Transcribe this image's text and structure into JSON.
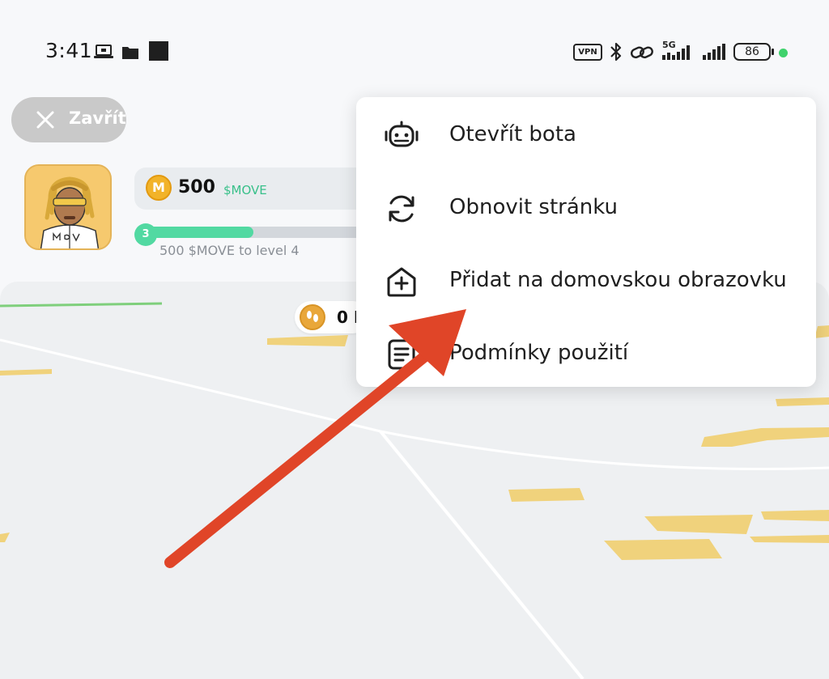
{
  "status_bar": {
    "time": "3:41",
    "vpn_label": "VPN",
    "network_label": "5G",
    "battery": "86",
    "icons": [
      "laptop-icon",
      "folder-icon",
      "square-icon",
      "vpn-icon",
      "bluetooth-icon",
      "link-icon",
      "signal-icon",
      "battery-icon"
    ]
  },
  "header": {
    "close_label": "Zavřít"
  },
  "profile": {
    "balance_amount": "500",
    "balance_currency": "$MOVE",
    "coin_letter": "M",
    "level": "3",
    "progress_fraction": 0.5,
    "progress_label": "500 $MOVE to level 4"
  },
  "map": {
    "steps_count": "0 I"
  },
  "menu": {
    "items": [
      {
        "label": "Otevřít bota",
        "icon": "robot-icon"
      },
      {
        "label": "Obnovit stránku",
        "icon": "refresh-icon"
      },
      {
        "label": "Přidat na domovskou obrazovku",
        "icon": "add-home-icon"
      },
      {
        "label": "Podmínky použití",
        "icon": "document-icon"
      }
    ]
  },
  "colors": {
    "accent_green": "#52d9a2",
    "coin_gold": "#f2b329",
    "arrow_red": "#e04528",
    "map_building": "#f0d27c"
  }
}
